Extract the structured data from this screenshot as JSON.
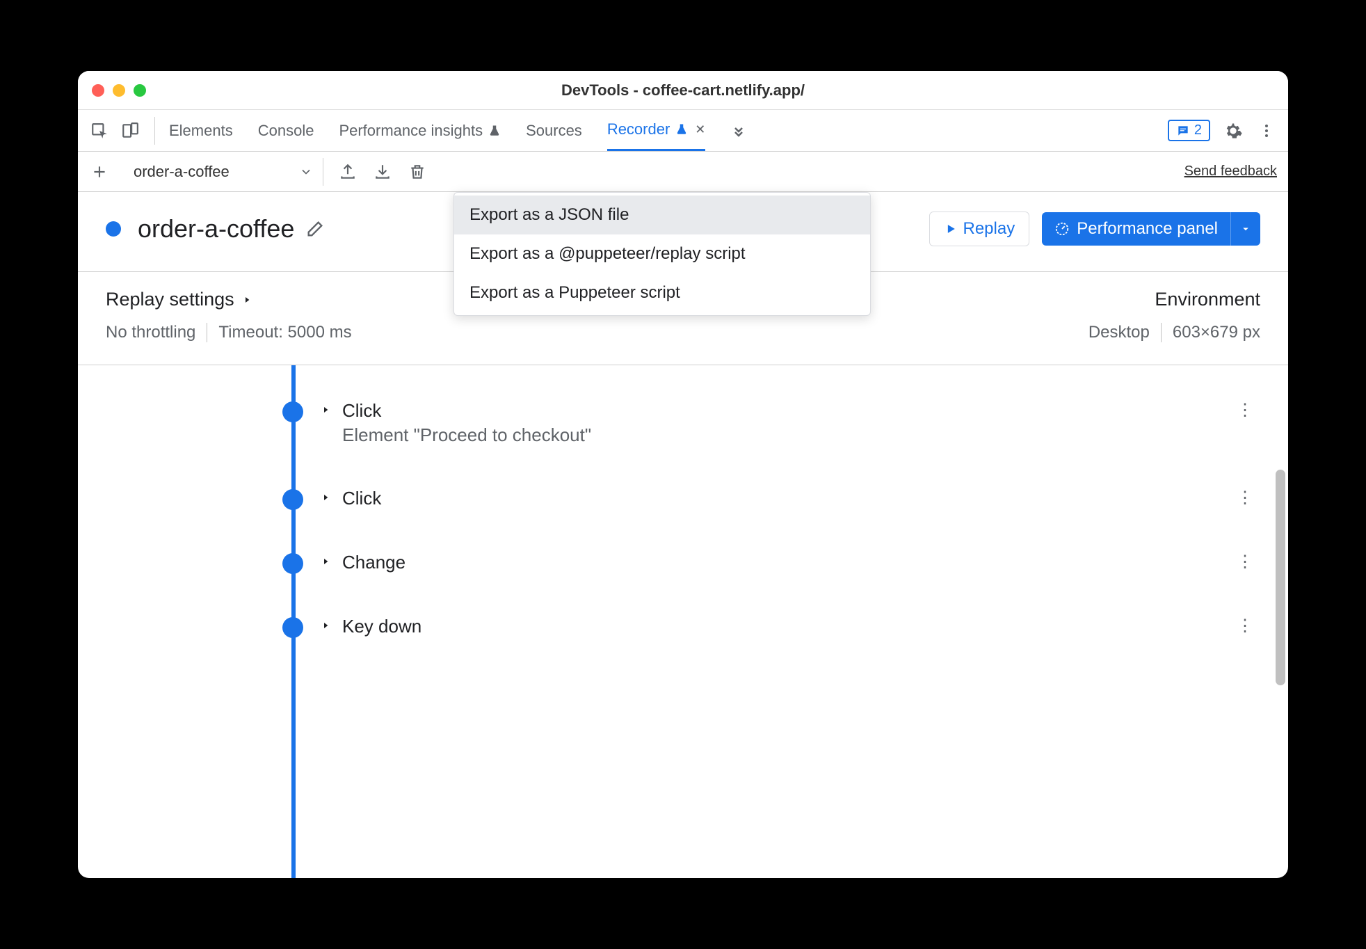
{
  "window": {
    "title": "DevTools - coffee-cart.netlify.app/"
  },
  "tabs": {
    "items": [
      {
        "label": "Elements",
        "active": false,
        "has_flask": false
      },
      {
        "label": "Console",
        "active": false,
        "has_flask": false
      },
      {
        "label": "Performance insights",
        "active": false,
        "has_flask": true
      },
      {
        "label": "Sources",
        "active": false,
        "has_flask": false
      },
      {
        "label": "Recorder",
        "active": true,
        "has_flask": true,
        "closeable": true
      }
    ],
    "issues_count": "2"
  },
  "toolbar": {
    "recording_name": "order-a-coffee",
    "send_feedback": "Send feedback"
  },
  "title_section": {
    "title": "order-a-coffee",
    "replay_label": "Replay",
    "perf_label": "Performance panel"
  },
  "export_menu": {
    "items": [
      "Export as a JSON file",
      "Export as a @puppeteer/replay script",
      "Export as a Puppeteer script"
    ]
  },
  "settings": {
    "replay_heading": "Replay settings",
    "throttling": "No throttling",
    "timeout": "Timeout: 5000 ms",
    "env_heading": "Environment",
    "device": "Desktop",
    "viewport": "603×679 px"
  },
  "steps": [
    {
      "title": "Click",
      "subtitle": "Element \"Proceed to checkout\""
    },
    {
      "title": "Click",
      "subtitle": ""
    },
    {
      "title": "Change",
      "subtitle": ""
    },
    {
      "title": "Key down",
      "subtitle": ""
    }
  ]
}
